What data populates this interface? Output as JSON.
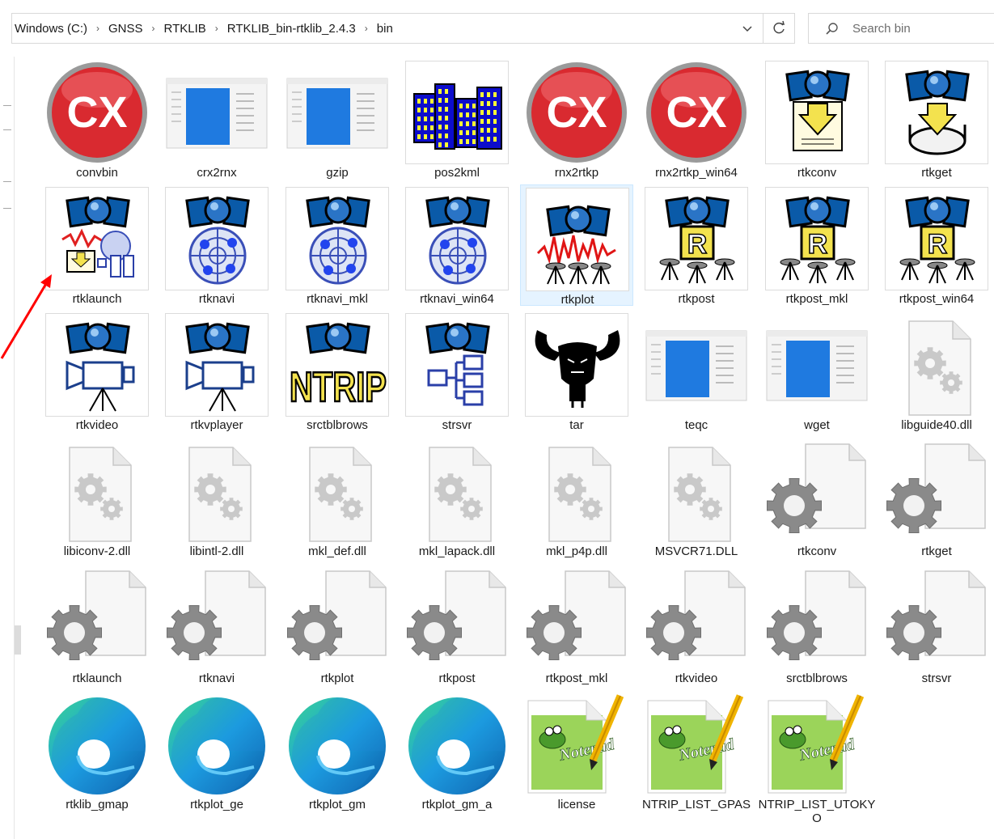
{
  "breadcrumb": [
    "Windows (C:)",
    "GNSS",
    "RTKLIB",
    "RTKLIB_bin-rtklib_2.4.3",
    "bin"
  ],
  "search": {
    "placeholder": "Search bin"
  },
  "files": [
    {
      "name": "convbin",
      "icon": "cx-icon"
    },
    {
      "name": "crx2rnx",
      "icon": "window-thumbnail-icon"
    },
    {
      "name": "gzip",
      "icon": "window-thumbnail-icon"
    },
    {
      "name": "pos2kml",
      "icon": "buildings-icon"
    },
    {
      "name": "rnx2rtkp",
      "icon": "cx-icon"
    },
    {
      "name": "rnx2rtkp_win64",
      "icon": "cx-icon"
    },
    {
      "name": "rtkconv",
      "icon": "satellite-convert-icon"
    },
    {
      "name": "rtkget",
      "icon": "satellite-download-icon"
    },
    {
      "name": "rtklaunch",
      "icon": "satellite-launch-icon"
    },
    {
      "name": "rtknavi",
      "icon": "satellite-radar-icon"
    },
    {
      "name": "rtknavi_mkl",
      "icon": "satellite-radar-icon"
    },
    {
      "name": "rtknavi_win64",
      "icon": "satellite-radar-icon"
    },
    {
      "name": "rtkplot",
      "icon": "satellite-plot-icon"
    },
    {
      "name": "rtkpost",
      "icon": "satellite-post-icon"
    },
    {
      "name": "rtkpost_mkl",
      "icon": "satellite-post-icon"
    },
    {
      "name": "rtkpost_win64",
      "icon": "satellite-post-icon"
    },
    {
      "name": "rtkvideo",
      "icon": "satellite-camera-icon"
    },
    {
      "name": "rtkvplayer",
      "icon": "satellite-camera-icon"
    },
    {
      "name": "srctblbrows",
      "icon": "satellite-ntrip-icon"
    },
    {
      "name": "strsvr",
      "icon": "satellite-tree-icon"
    },
    {
      "name": "tar",
      "icon": "gnu-icon"
    },
    {
      "name": "teqc",
      "icon": "window-thumbnail-icon"
    },
    {
      "name": "wget",
      "icon": "window-thumbnail-icon"
    },
    {
      "name": "libguide40.dll",
      "icon": "dll-file-icon"
    },
    {
      "name": "libiconv-2.dll",
      "icon": "dll-file-icon"
    },
    {
      "name": "libintl-2.dll",
      "icon": "dll-file-icon"
    },
    {
      "name": "mkl_def.dll",
      "icon": "dll-file-icon"
    },
    {
      "name": "mkl_lapack.dll",
      "icon": "dll-file-icon"
    },
    {
      "name": "mkl_p4p.dll",
      "icon": "dll-file-icon"
    },
    {
      "name": "MSVCR71.DLL",
      "icon": "dll-file-icon"
    },
    {
      "name": "rtkconv",
      "icon": "settings-file-icon"
    },
    {
      "name": "rtkget",
      "icon": "settings-file-icon"
    },
    {
      "name": "rtklaunch",
      "icon": "settings-file-icon"
    },
    {
      "name": "rtknavi",
      "icon": "settings-file-icon"
    },
    {
      "name": "rtkplot",
      "icon": "settings-file-icon"
    },
    {
      "name": "rtkpost",
      "icon": "settings-file-icon"
    },
    {
      "name": "rtkpost_mkl",
      "icon": "settings-file-icon"
    },
    {
      "name": "rtkvideo",
      "icon": "settings-file-icon"
    },
    {
      "name": "srctblbrows",
      "icon": "settings-file-icon"
    },
    {
      "name": "strsvr",
      "icon": "settings-file-icon"
    },
    {
      "name": "rtklib_gmap",
      "icon": "edge-html-icon"
    },
    {
      "name": "rtkplot_ge",
      "icon": "edge-html-icon"
    },
    {
      "name": "rtkplot_gm",
      "icon": "edge-html-icon"
    },
    {
      "name": "rtkplot_gm_a",
      "icon": "edge-html-icon"
    },
    {
      "name": "license",
      "icon": "notepadpp-file-icon"
    },
    {
      "name": "NTRIP_LIST_GPAS",
      "icon": "notepadpp-file-icon"
    },
    {
      "name": "NTRIP_LIST_UTOKYO",
      "icon": "notepadpp-file-icon"
    }
  ],
  "selected_file": "rtkplot",
  "colors": {
    "accent_selection": "#e5f3ff",
    "annotation_arrow": "#ff0000"
  }
}
